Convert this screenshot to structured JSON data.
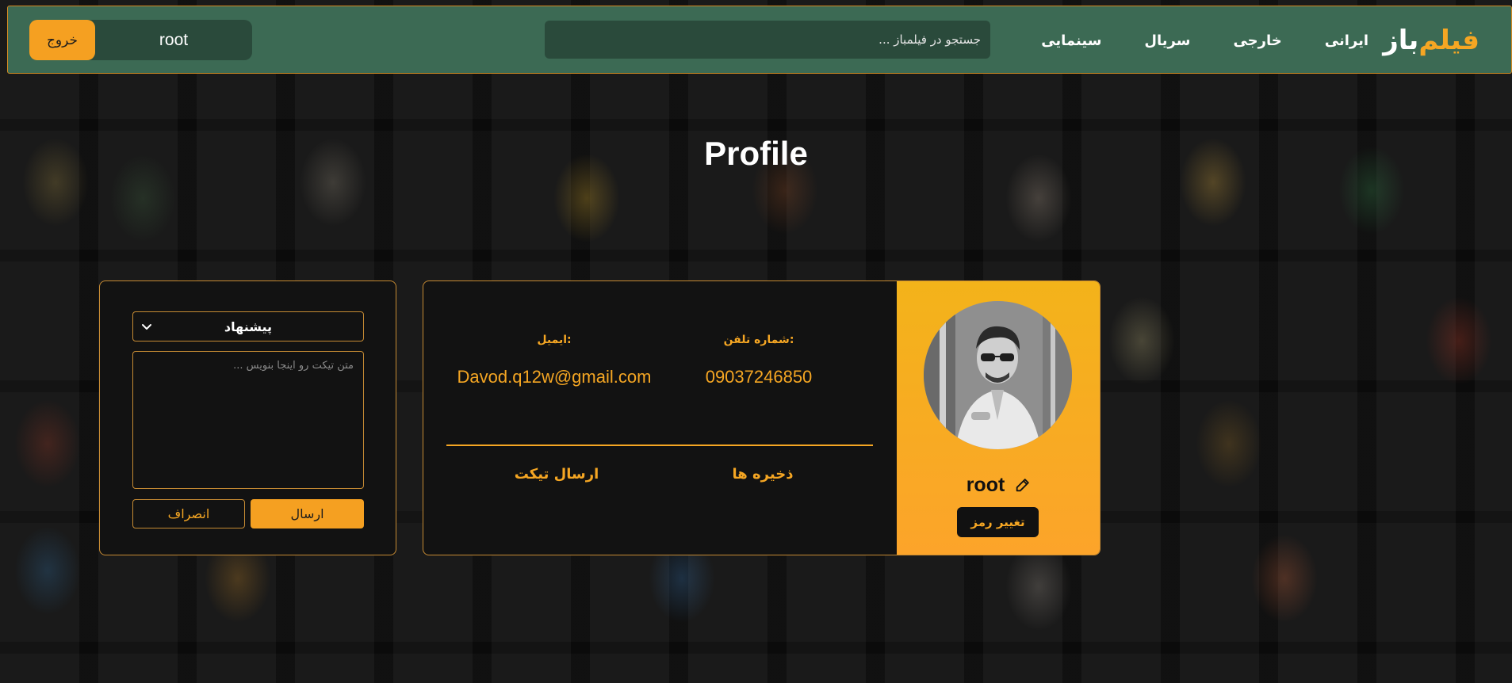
{
  "header": {
    "logo_text": "فیلم",
    "logo_accent": "باز",
    "nav": [
      "ایرانی",
      "خارجی",
      "سریال",
      "سینمایی"
    ],
    "search_placeholder": "جستجو در فیلمباز ...",
    "username": "root",
    "logout_label": "خروج"
  },
  "page": {
    "title": "Profile"
  },
  "ticket": {
    "type_selected": "پیشنهاد",
    "text_placeholder": "متن تیکت رو اینجا بنویس ...",
    "send_label": "ارسال",
    "cancel_label": "انصراف"
  },
  "profile": {
    "phone_label": "شماره تلفن:",
    "phone_value": "09037246850",
    "email_label": "ایمیل:",
    "email_value": "Davod.q12w@gmail.com",
    "saved_label": "ذخیره ها",
    "send_ticket_label": "ارسال تیکت",
    "username": "root",
    "change_password_label": "تغییر رمز"
  },
  "colors": {
    "accent": "#f5a623",
    "header_bg": "#3c6a54",
    "panel_bg": "#121212"
  },
  "icons": {
    "edit": "edit-icon",
    "chevron": "chevron-down-icon"
  }
}
